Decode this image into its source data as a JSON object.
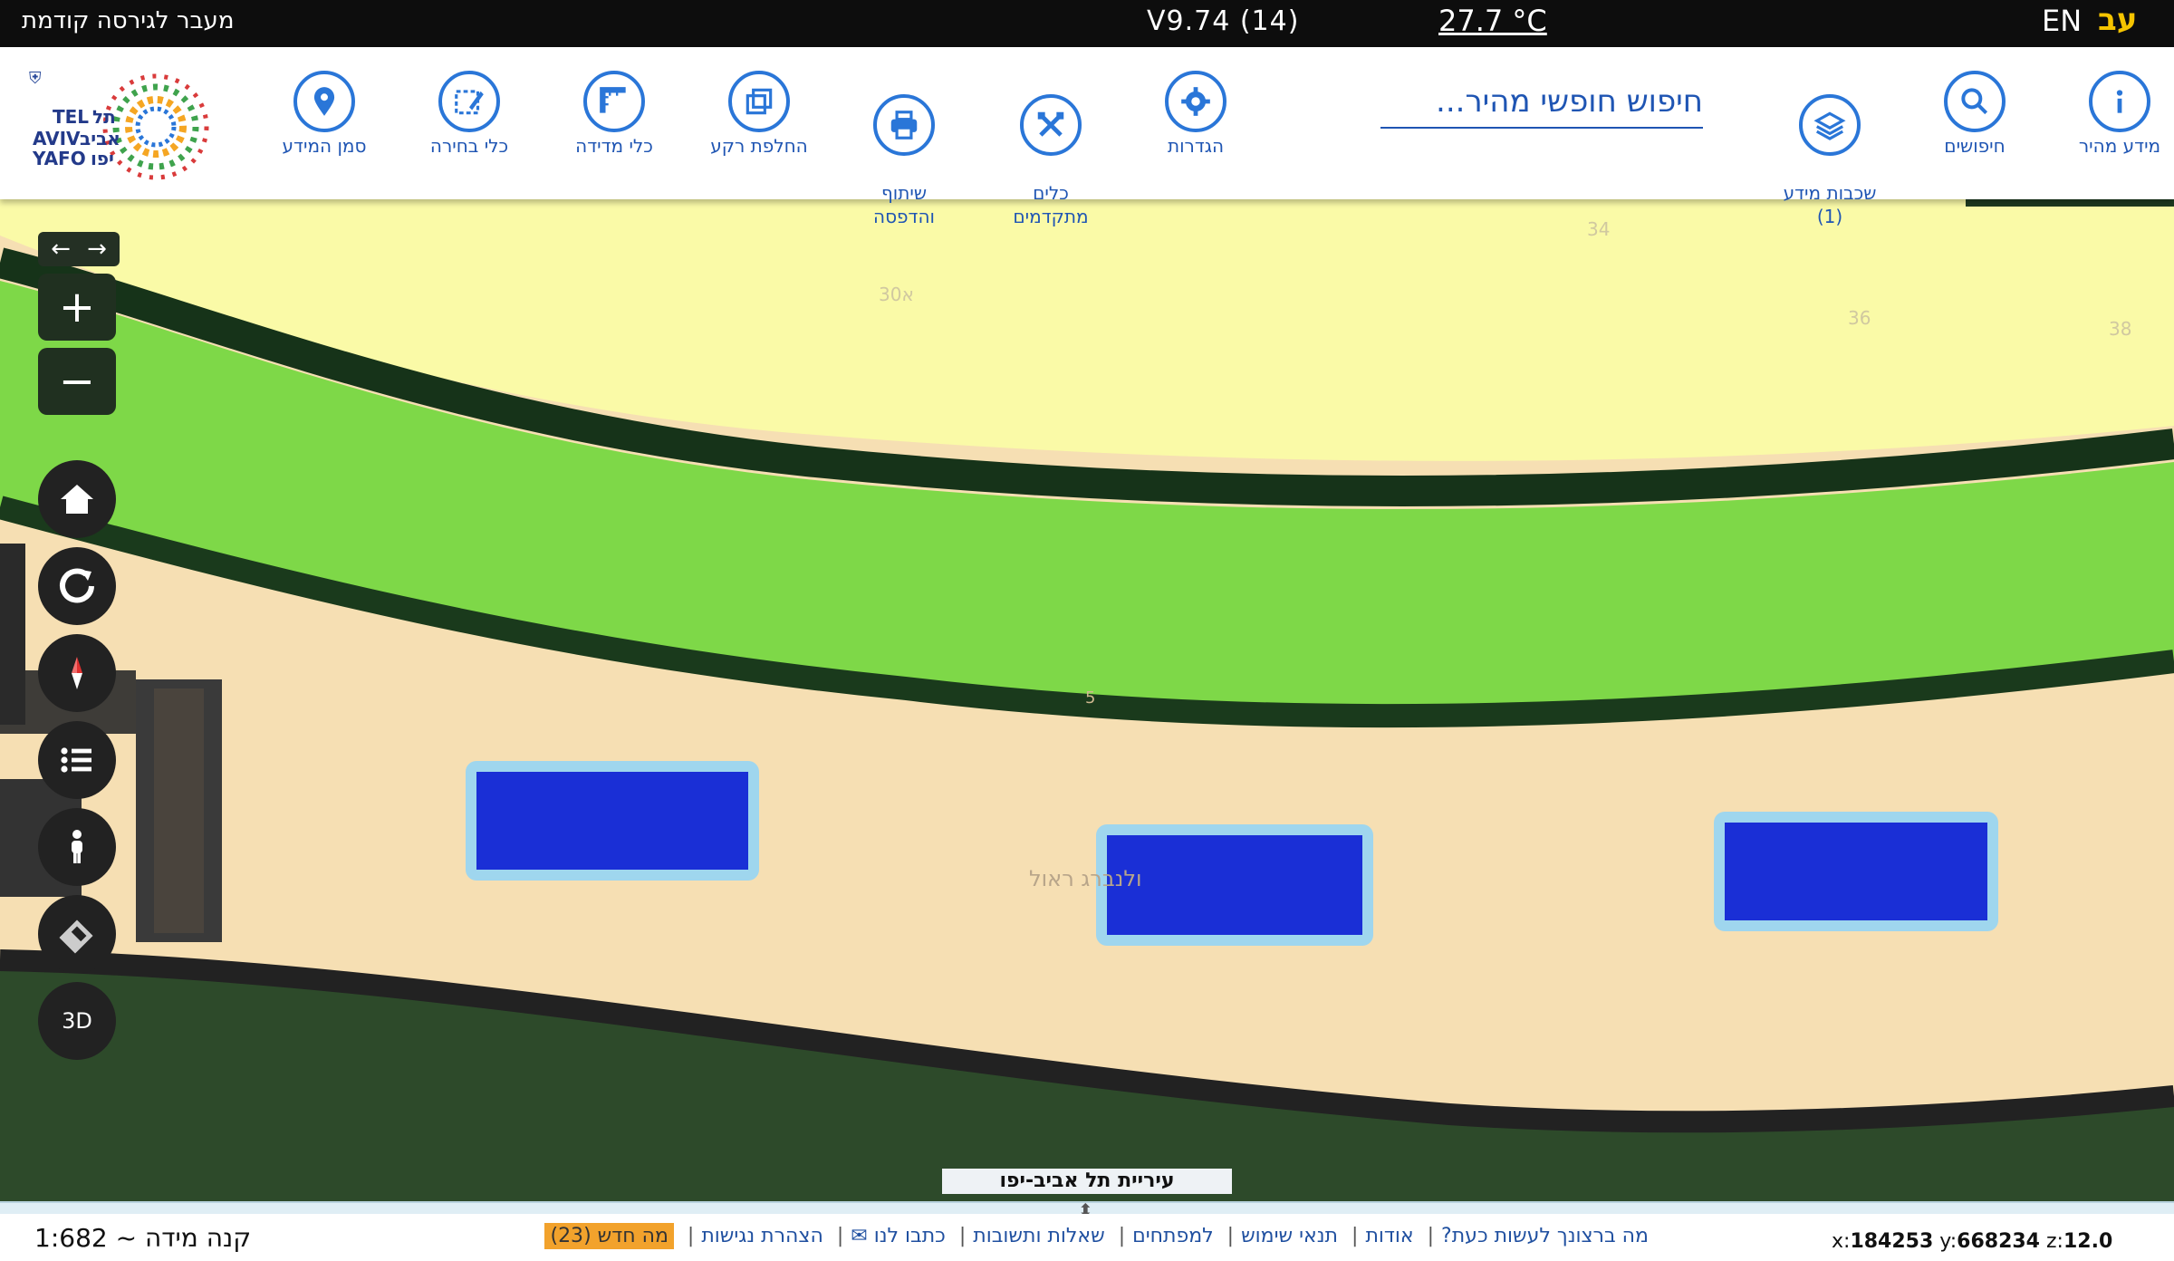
{
  "topbar": {
    "prev_version": "מעבר לגירסה קודמת",
    "version": "V9.74 (14)",
    "temperature": "27.7 °C",
    "lang_en": "EN",
    "lang_he": "עב"
  },
  "toolbar": {
    "items": [
      {
        "label": "מידע מהיר",
        "icon": "info-icon"
      },
      {
        "label": "חיפושים",
        "icon": "search-icon"
      },
      {
        "label": "שכבות מידע\n(1)",
        "icon": "layers-icon"
      },
      {
        "label": "הגדרות",
        "icon": "gear-icon"
      },
      {
        "label": "כלים\nמתקדמים",
        "icon": "tools-icon"
      },
      {
        "label": "שיתוף\nוהדפסה",
        "icon": "print-icon"
      },
      {
        "label": "החלפת רקע",
        "icon": "background-icon"
      },
      {
        "label": "כלי מדידה",
        "icon": "ruler-icon"
      },
      {
        "label": "כלי בחירה",
        "icon": "select-icon"
      },
      {
        "label": "סמן המידע",
        "icon": "pin-icon"
      }
    ],
    "search_placeholder": "חיפוש חופשי מהיר..."
  },
  "logo": {
    "text_he_1": "תל",
    "text_he_2": "אביב",
    "text_he_3": "יפו",
    "text_en_1": "TEL",
    "text_en_2": "AVIV",
    "text_en_3": "YAFO"
  },
  "controls": {
    "zoom_in": "+",
    "zoom_out": "−",
    "three_d": "3D",
    "icons": [
      "home-icon",
      "refresh-icon",
      "compass-icon",
      "list-icon",
      "streetview-icon",
      "eraser-icon"
    ]
  },
  "map": {
    "labels": [
      "30א",
      "34",
      "36",
      "38",
      "5",
      "ולנברג ראול"
    ],
    "city_label": "עיריית תל אביב-יפו"
  },
  "footer": {
    "scale": "קנה מידה ~ 1:682",
    "links": [
      "מה ברצונך לעשות כעת?",
      "אודות",
      "תנאי שימוש",
      "למפתחים",
      "שאלות ותשובות",
      "כתבו לנו ✉",
      "הצהרת נגישות"
    ],
    "news": "מה חדש (23)",
    "coord_x_label": "x:",
    "coord_x": "184253",
    "coord_y_label": "y:",
    "coord_y": "668234",
    "coord_z_label": "z:",
    "coord_z": "12.0"
  }
}
